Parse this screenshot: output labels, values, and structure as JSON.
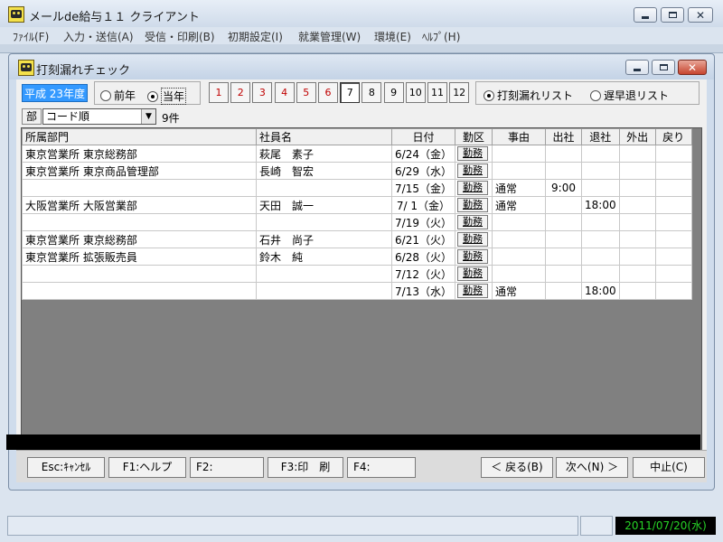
{
  "app": {
    "title": "メールde給与１１ クライアント"
  },
  "menu": [
    "ﾌｧｲﾙ(F)",
    "入力・送信(A)",
    "受信・印刷(B)",
    "初期設定(I)",
    "就業管理(W)",
    "環境(E)",
    "ﾍﾙﾌﾟ(H)"
  ],
  "window": {
    "title": "打刻漏れチェック"
  },
  "era": "平成 23年度",
  "year_options": {
    "prev": "前年",
    "current": "当年",
    "selected": "current"
  },
  "months": [
    "1",
    "2",
    "3",
    "4",
    "5",
    "6",
    "7",
    "8",
    "9",
    "10",
    "11",
    "12"
  ],
  "months_red": [
    "1",
    "2",
    "3",
    "4",
    "5",
    "6"
  ],
  "selected_month": "7",
  "list_options": {
    "missing": "打刻漏れリスト",
    "late": "遅早退リスト",
    "selected": "missing"
  },
  "sort": {
    "label": "部",
    "value": "コード順",
    "count": "9件"
  },
  "table": {
    "columns": [
      "所属部門",
      "社員名",
      "日付",
      "勤区",
      "事由",
      "出社",
      "退社",
      "外出",
      "戻り"
    ],
    "button_label": "勤務",
    "rows": [
      {
        "dept": "東京営業所 東京総務部",
        "name": "萩尾　素子",
        "date": "6/24（金）",
        "reason": "",
        "in": "",
        "out": "",
        "go": "",
        "back": ""
      },
      {
        "dept": "東京営業所 東京商品管理部",
        "name": "長崎　智宏",
        "date": "6/29（水）",
        "reason": "",
        "in": "",
        "out": "",
        "go": "",
        "back": ""
      },
      {
        "dept": "",
        "name": "",
        "date": "7/15（金）",
        "reason": "通常",
        "in": "9:00",
        "out": "",
        "go": "",
        "back": ""
      },
      {
        "dept": "大阪営業所 大阪営業部",
        "name": "天田　誠一",
        "date": "7/ 1（金）",
        "reason": "通常",
        "in": "",
        "out": "18:00",
        "go": "",
        "back": ""
      },
      {
        "dept": "",
        "name": "",
        "date": "7/19（火）",
        "reason": "",
        "in": "",
        "out": "",
        "go": "",
        "back": ""
      },
      {
        "dept": "東京営業所 東京総務部",
        "name": "石井　尚子",
        "date": "6/21（火）",
        "reason": "",
        "in": "",
        "out": "",
        "go": "",
        "back": ""
      },
      {
        "dept": "東京営業所 拡張販売員",
        "name": "鈴木　純",
        "date": "6/28（火）",
        "reason": "",
        "in": "",
        "out": "",
        "go": "",
        "back": ""
      },
      {
        "dept": "",
        "name": "",
        "date": "7/12（火）",
        "reason": "",
        "in": "",
        "out": "",
        "go": "",
        "back": ""
      },
      {
        "dept": "",
        "name": "",
        "date": "7/13（水）",
        "reason": "通常",
        "in": "",
        "out": "18:00",
        "go": "",
        "back": ""
      }
    ]
  },
  "fkeys": {
    "esc": "Esc:ｷｬﾝｾﾙ",
    "f1": "F1:ヘルプ",
    "f2": "F2:",
    "f3": "F3:印　刷",
    "f4": "F4:",
    "back": "＜ 戻る(B)",
    "next": "次へ(N) ＞",
    "stop": "中止(C)"
  },
  "status": {
    "date": "2011/07/20(水)"
  }
}
